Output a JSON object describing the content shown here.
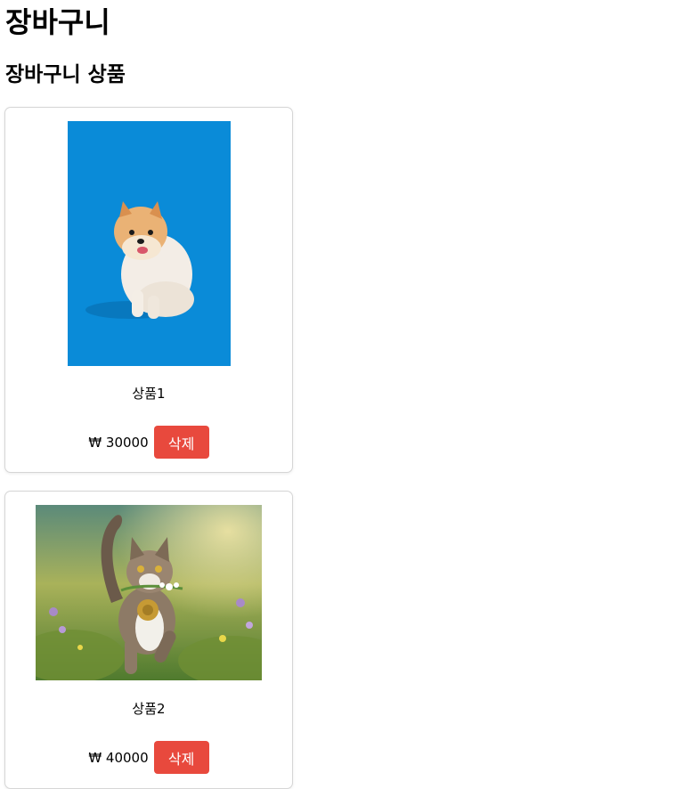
{
  "page": {
    "title": "장바구니"
  },
  "cart": {
    "heading": "장바구니 상품",
    "currency": "₩",
    "items": [
      {
        "name": "상품1",
        "price": "₩ 30000",
        "delete_label": "삭제",
        "image": "pomeranian-dog-photo",
        "image_bg": "#0a8bd8"
      },
      {
        "name": "상품2",
        "price": "₩ 40000",
        "delete_label": "삭제",
        "image": "cat-with-flower-photo"
      }
    ]
  },
  "colors": {
    "delete_button": "#e8493d",
    "card_border": "#d6d6d6"
  }
}
